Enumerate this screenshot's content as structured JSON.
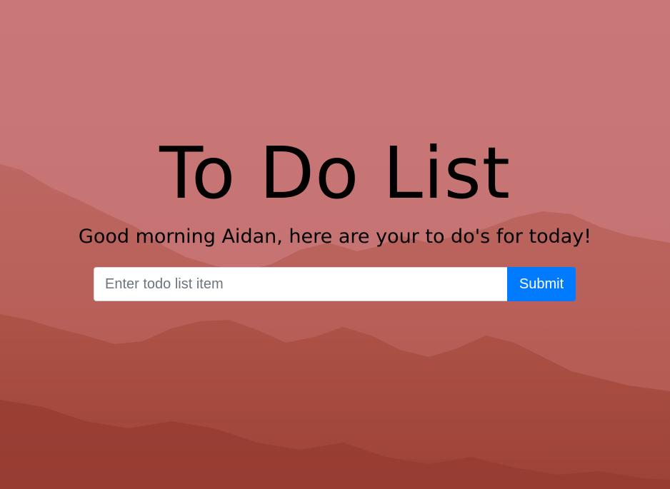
{
  "header": {
    "title": "To Do List",
    "greeting": "Good morning Aidan, here are your to do's for today!"
  },
  "form": {
    "input_placeholder": "Enter todo list item",
    "input_value": "",
    "submit_label": "Submit"
  },
  "colors": {
    "sky": "#c87778",
    "mountain_far": "#b86059",
    "mountain_near": "#a5473b",
    "button": "#007bff",
    "text": "#000000"
  }
}
